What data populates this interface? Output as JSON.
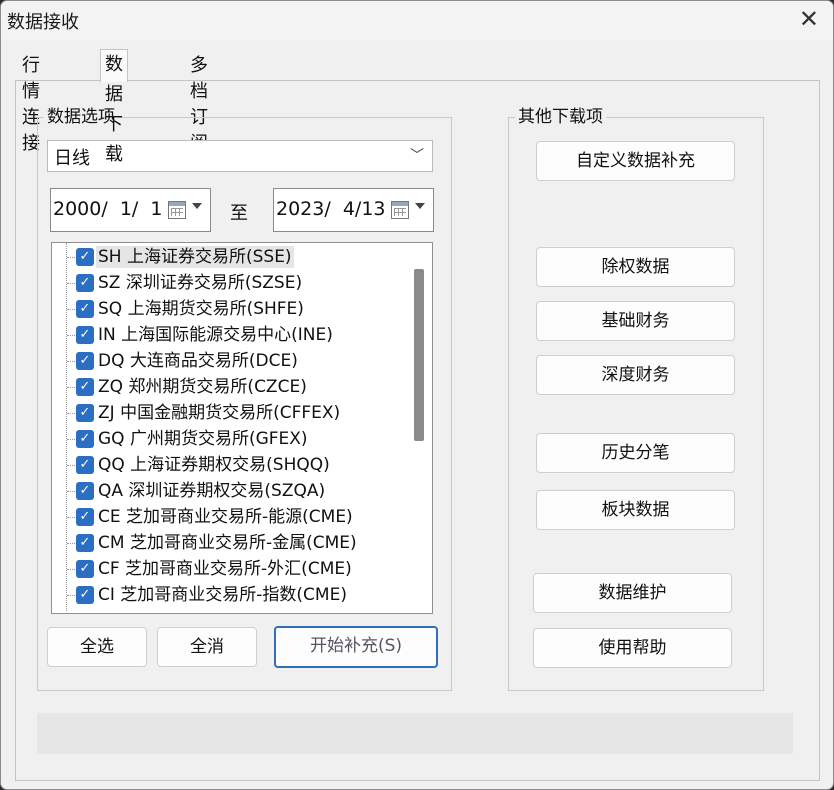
{
  "window": {
    "title": "数据接收",
    "close_glyph": "✕"
  },
  "tabs": [
    {
      "label": "行情连接"
    },
    {
      "label": "数据下载"
    },
    {
      "label": "多档订阅"
    }
  ],
  "data_options": {
    "group_label": "数据选项",
    "period": {
      "selected": "日线"
    },
    "start_date": "2000/  1/  1",
    "to_label": "至",
    "end_date": "2023/  4/13",
    "markets": [
      {
        "label": "SH 上海证券交易所(SSE)",
        "checked": true
      },
      {
        "label": "SZ 深圳证券交易所(SZSE)",
        "checked": true
      },
      {
        "label": "SQ 上海期货交易所(SHFE)",
        "checked": true
      },
      {
        "label": "IN 上海国际能源交易中心(INE)",
        "checked": true
      },
      {
        "label": "DQ 大连商品交易所(DCE)",
        "checked": true
      },
      {
        "label": "ZQ 郑州期货交易所(CZCE)",
        "checked": true
      },
      {
        "label": "ZJ 中国金融期货交易所(CFFEX)",
        "checked": true
      },
      {
        "label": "GQ 广州期货交易所(GFEX)",
        "checked": true
      },
      {
        "label": "QQ 上海证券期权交易(SHQQ)",
        "checked": true
      },
      {
        "label": "QA 深圳证券期权交易(SZQA)",
        "checked": true
      },
      {
        "label": "CE 芝加哥商业交易所-能源(CME)",
        "checked": true
      },
      {
        "label": "CM 芝加哥商业交易所-金属(CME)",
        "checked": true
      },
      {
        "label": "CF 芝加哥商业交易所-外汇(CME)",
        "checked": true
      },
      {
        "label": "CI 芝加哥商业交易所-指数(CME)",
        "checked": true
      }
    ],
    "select_all": "全选",
    "deselect_all": "全消",
    "start_fill": "开始补充(S)"
  },
  "other_downloads": {
    "group_label": "其他下载项",
    "buttons": [
      {
        "label": "自定义数据补充"
      },
      {
        "label": "除权数据"
      },
      {
        "label": "基础财务"
      },
      {
        "label": "深度财务"
      },
      {
        "label": "历史分笔"
      },
      {
        "label": "板块数据"
      },
      {
        "label": "数据维护"
      },
      {
        "label": "使用帮助"
      }
    ]
  },
  "colors": {
    "accent": "#2a6fc4",
    "primary_border": "#2e6fb5"
  }
}
